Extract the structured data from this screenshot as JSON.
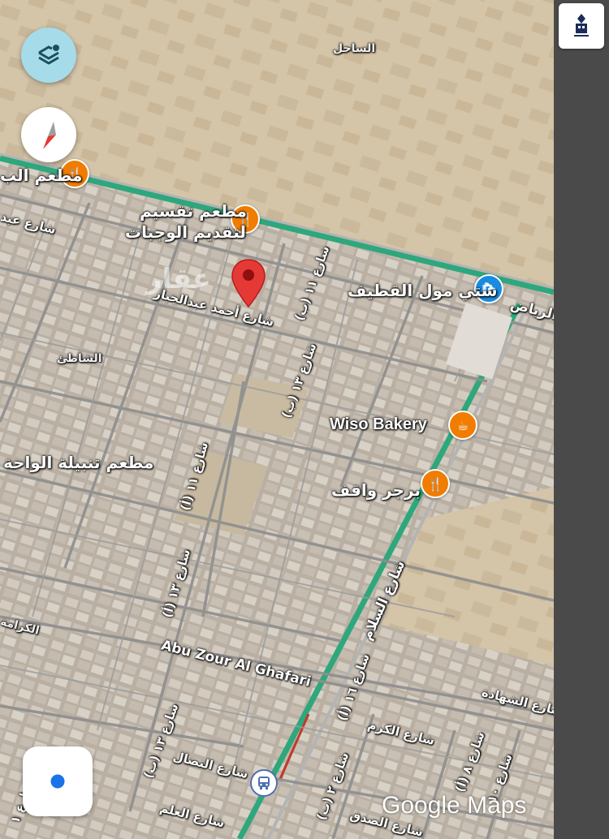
{
  "map": {
    "provider_logo": "Google Maps",
    "watermark": "عقار",
    "controls": {
      "layers": "layers-icon",
      "compass": "compass-icon",
      "locate": "my-location-icon"
    },
    "pois": [
      {
        "name": "poi-restaurant-top-left",
        "label": "مطعم الب",
        "icon": "restaurant-icon",
        "color": "#f07c00"
      },
      {
        "name": "poi-restaurant-taqseem",
        "label": "مطعم تقسيم",
        "label2": "لتقديم الوجبات",
        "icon": "restaurant-icon",
        "color": "#f07c00"
      },
      {
        "name": "poi-city-mall",
        "label": "ستي مول القطيف",
        "icon": "shopping-icon",
        "color": "#1a8ce0"
      },
      {
        "name": "poi-wiso-bakery",
        "label": "Wiso Bakery",
        "icon": "cafe-icon",
        "color": "#f07c00"
      },
      {
        "name": "poi-burger-waqif",
        "label": "برجر واقف",
        "icon": "restaurant-icon",
        "color": "#f07c00"
      },
      {
        "name": "poi-tanbila",
        "label": "مطعم تنبيلة الواحة",
        "icon": "",
        "color": ""
      }
    ],
    "areas": {
      "sahel": "الساحل",
      "shati": "الشاطئ",
      "karama": "الكرامة"
    },
    "streets": {
      "abd": "شارع عبد",
      "ahmad": "شارع أحمد عبدالجبار",
      "s11b": "شارع ١١ (ب)",
      "s13b": "شارع ١٣ (ب)",
      "s11": "شارع ١١ (أ)",
      "s13": "شارع ١٣ (أ)",
      "riyadh": "الرياض",
      "salam": "شارع السلام",
      "abuzour": "Abu Zour Al Ghafari",
      "s13b2": "شارع ١٣ (ب)",
      "s16": "شارع ١٦ (أ)",
      "shahada": "شارع الشهادة",
      "karam": "شارع الكرم",
      "nidal": "شارع النضال",
      "alam": "شارع العلم",
      "s2b": "شارع ٢ (ب)",
      "sidq": "شارع الصدق",
      "s8": "شارع ٨ (أ)",
      "s10": "شارع ١٠",
      "s1": "شارع ١"
    }
  }
}
